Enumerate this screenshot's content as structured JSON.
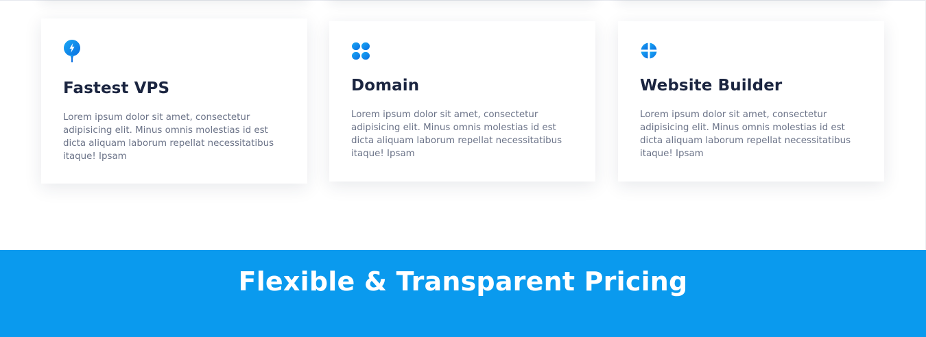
{
  "features": {
    "cards": [
      {
        "icon": "lightning-bolt-pin-icon",
        "title": "Fastest VPS",
        "description": "Lorem ipsum dolor sit amet, consectetur adipisicing elit. Minus omnis molestias id est dicta aliquam laborum repellat necessitatibus itaque! Ipsam"
      },
      {
        "icon": "four-dots-grid-icon",
        "title": "Domain",
        "description": "Lorem ipsum dolor sit amet, consectetur adipisicing elit. Minus omnis molestias id est dicta aliquam laborum repellat necessitatibus itaque! Ipsam"
      },
      {
        "icon": "pie-chart-icon",
        "title": "Website Builder",
        "description": "Lorem ipsum dolor sit amet, consectetur adipisicing elit. Minus omnis molestias id est dicta aliquam laborum repellat necessitatibus itaque! Ipsam"
      }
    ]
  },
  "pricing": {
    "heading": "Flexible & Transparent Pricing"
  },
  "colors": {
    "accent": "#0a9aee",
    "icon_gradient_start": "#1aa8f5",
    "icon_gradient_end": "#0a6fe0",
    "heading_text": "#1b2540",
    "body_text": "#6b7388",
    "banner_text": "#ffffff"
  }
}
